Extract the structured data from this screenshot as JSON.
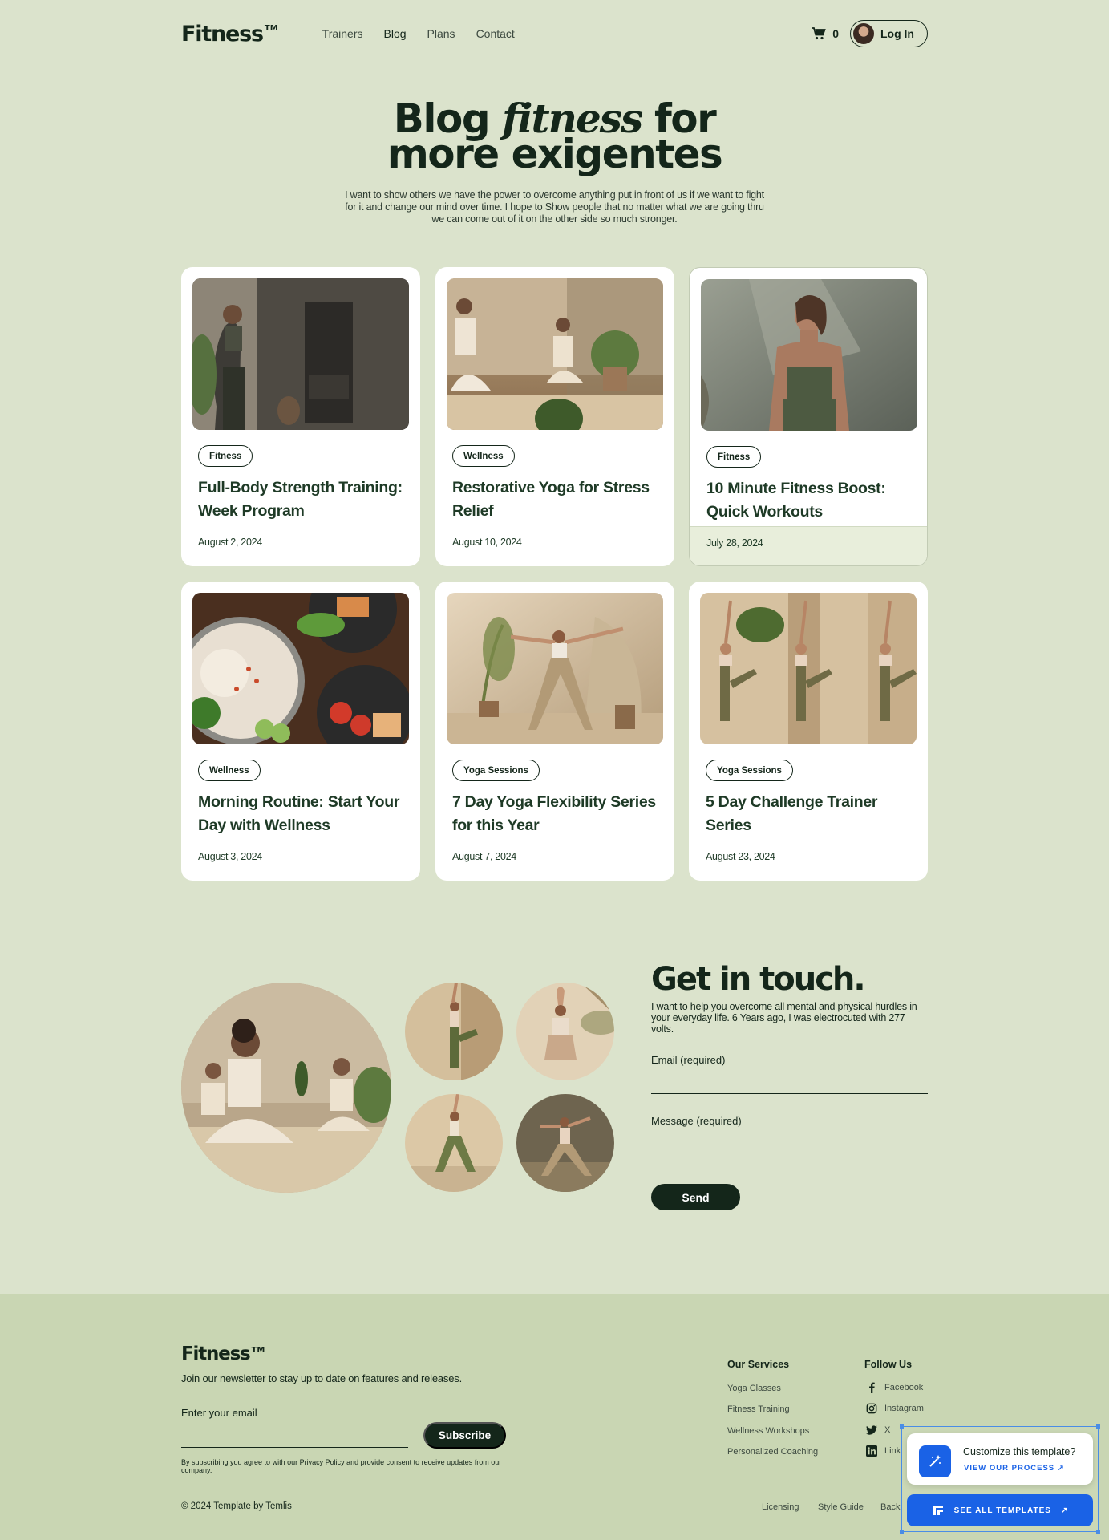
{
  "brand": {
    "name": "Fitness",
    "tm": "TM"
  },
  "nav": {
    "items": [
      {
        "label": "Trainers"
      },
      {
        "label": "Blog",
        "active": true
      },
      {
        "label": "Plans"
      },
      {
        "label": "Contact"
      }
    ]
  },
  "header": {
    "cart_count": "0",
    "login_label": "Log In"
  },
  "hero": {
    "title_pre": "Blog ",
    "title_em": "fitness",
    "title_post": " for",
    "title_line2": "more exigentes",
    "subtitle": "I want to show others we have the power to overcome anything put in front of us if we want to fight for it and change our mind over time. I hope to Show people that no matter what we are going thru we can come out of it on the other side so much stronger."
  },
  "posts": [
    {
      "tag": "Fitness",
      "title": "Full-Body Strength Training: Week Program",
      "date": "August 2, 2024"
    },
    {
      "tag": "Wellness",
      "title": "Restorative Yoga for Stress Relief",
      "date": "August 10, 2024"
    },
    {
      "tag": "Fitness",
      "title": "10 Minute Fitness Boost: Quick Workouts",
      "date": "July 28, 2024"
    },
    {
      "tag": "Wellness",
      "title": "Morning Routine: Start Your Day with Wellness",
      "date": "August 3, 2024"
    },
    {
      "tag": "Yoga Sessions",
      "title": "7 Day Yoga Flexibility Series for this Year",
      "date": "August 7, 2024"
    },
    {
      "tag": "Yoga Sessions",
      "title": "5 Day Challenge Trainer Series",
      "date": "August 23, 2024"
    }
  ],
  "contact": {
    "title": "Get in touch.",
    "subtitle": "I want to help you overcome all mental and physical hurdles in your everyday life. 6 Years ago, I was electrocuted with 277 volts.",
    "email_label": "Email (required)",
    "message_label": "Message (required)",
    "send_label": "Send"
  },
  "footer": {
    "newsletter_text": "Join our newsletter to stay up to date on features and releases.",
    "email_placeholder": "Enter your email",
    "subscribe_label": "Subscribe",
    "legal": "By subscribing you agree to with our Privacy Policy and provide consent to receive updates from our company.",
    "copyright": "© 2024 Template by Temlis",
    "services_title": "Our Services",
    "services": [
      "Yoga Classes",
      "Fitness Training",
      "Wellness Workshops",
      "Personalized Coaching"
    ],
    "follow_title": "Follow Us",
    "social": [
      {
        "label": "Facebook",
        "icon": "facebook-icon"
      },
      {
        "label": "Instagram",
        "icon": "instagram-icon"
      },
      {
        "label": "X",
        "icon": "x-icon"
      },
      {
        "label": "Link",
        "icon": "linkedin-icon"
      }
    ],
    "bottom_links": [
      "Licensing",
      "Style Guide",
      "Back"
    ]
  },
  "widget": {
    "title": "Customize this template?",
    "process_label": "VIEW OUR PROCESS",
    "all_templates_label": "SEE ALL TEMPLATES"
  }
}
